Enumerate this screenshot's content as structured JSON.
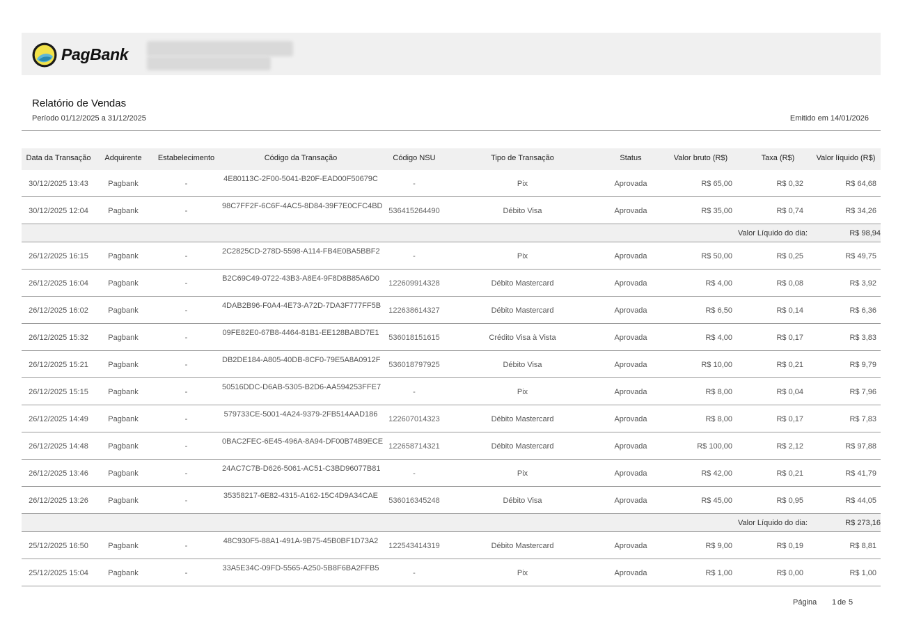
{
  "brand": {
    "name": "PagBank"
  },
  "report": {
    "title": "Relatório de Vendas",
    "period": "Período 01/12/2025 a 31/12/2025",
    "issued": "Emitido em 14/01/2026"
  },
  "table": {
    "headers": {
      "date": "Data da Transação",
      "acquirer": "Adquirente",
      "establishment": "Estabelecimento",
      "code": "Código da Transação",
      "nsu": "Código NSU",
      "type": "Tipo de Transação",
      "status": "Status",
      "gross": "Valor bruto (R$)",
      "fee": "Taxa (R$)",
      "net": "Valor líquido (R$)"
    },
    "sections": [
      {
        "rows": [
          {
            "date": "30/12/2025 13:43",
            "acquirer": "Pagbank",
            "establishment": "-",
            "code": "4E80113C-2F00-5041-B20F-EAD00F50679C",
            "nsu": "-",
            "type": "Pix",
            "status": "Aprovada",
            "gross": "R$ 65,00",
            "fee": "R$ 0,32",
            "net": "R$ 64,68"
          },
          {
            "date": "30/12/2025 12:04",
            "acquirer": "Pagbank",
            "establishment": "-",
            "code": "98C7FF2F-6C6F-4AC5-8D84-39F7E0CFC4BD",
            "nsu": "536415264490",
            "type": "Débito Visa",
            "status": "Aprovada",
            "gross": "R$ 35,00",
            "fee": "R$ 0,74",
            "net": "R$ 34,26"
          }
        ],
        "subtotal_label": "Valor Líquido do dia:",
        "subtotal_value": "R$ 98,94"
      },
      {
        "rows": [
          {
            "date": "26/12/2025 16:15",
            "acquirer": "Pagbank",
            "establishment": "-",
            "code": "2C2825CD-278D-5598-A114-FB4E0BA5BBF2",
            "nsu": "-",
            "type": "Pix",
            "status": "Aprovada",
            "gross": "R$ 50,00",
            "fee": "R$ 0,25",
            "net": "R$ 49,75"
          },
          {
            "date": "26/12/2025 16:04",
            "acquirer": "Pagbank",
            "establishment": "-",
            "code": "B2C69C49-0722-43B3-A8E4-9F8D8B85A6D0",
            "nsu": "122609914328",
            "type": "Débito Mastercard",
            "status": "Aprovada",
            "gross": "R$ 4,00",
            "fee": "R$ 0,08",
            "net": "R$ 3,92"
          },
          {
            "date": "26/12/2025 16:02",
            "acquirer": "Pagbank",
            "establishment": "-",
            "code": "4DAB2B96-F0A4-4E73-A72D-7DA3F777FF5B",
            "nsu": "122638614327",
            "type": "Débito Mastercard",
            "status": "Aprovada",
            "gross": "R$ 6,50",
            "fee": "R$ 0,14",
            "net": "R$ 6,36"
          },
          {
            "date": "26/12/2025 15:32",
            "acquirer": "Pagbank",
            "establishment": "-",
            "code": "09FE82E0-67B8-4464-81B1-EE128BABD7E1",
            "nsu": "536018151615",
            "type": "Crédito Visa à Vista",
            "status": "Aprovada",
            "gross": "R$ 4,00",
            "fee": "R$ 0,17",
            "net": "R$ 3,83"
          },
          {
            "date": "26/12/2025 15:21",
            "acquirer": "Pagbank",
            "establishment": "-",
            "code": "DB2DE184-A805-40DB-8CF0-79E5A8A0912F",
            "nsu": "536018797925",
            "type": "Débito Visa",
            "status": "Aprovada",
            "gross": "R$ 10,00",
            "fee": "R$ 0,21",
            "net": "R$ 9,79"
          },
          {
            "date": "26/12/2025 15:15",
            "acquirer": "Pagbank",
            "establishment": "-",
            "code": "50516DDC-D6AB-5305-B2D6-AA594253FFE7",
            "nsu": "-",
            "type": "Pix",
            "status": "Aprovada",
            "gross": "R$ 8,00",
            "fee": "R$ 0,04",
            "net": "R$ 7,96"
          },
          {
            "date": "26/12/2025 14:49",
            "acquirer": "Pagbank",
            "establishment": "-",
            "code": "579733CE-5001-4A24-9379-2FB514AAD186",
            "nsu": "122607014323",
            "type": "Débito Mastercard",
            "status": "Aprovada",
            "gross": "R$ 8,00",
            "fee": "R$ 0,17",
            "net": "R$ 7,83"
          },
          {
            "date": "26/12/2025 14:48",
            "acquirer": "Pagbank",
            "establishment": "-",
            "code": "0BAC2FEC-6E45-496A-8A94-DF00B74B9ECE",
            "nsu": "122658714321",
            "type": "Débito Mastercard",
            "status": "Aprovada",
            "gross": "R$ 100,00",
            "fee": "R$ 2,12",
            "net": "R$ 97,88"
          },
          {
            "date": "26/12/2025 13:46",
            "acquirer": "Pagbank",
            "establishment": "-",
            "code": "24AC7C7B-D626-5061-AC51-C3BD96077B81",
            "nsu": "-",
            "type": "Pix",
            "status": "Aprovada",
            "gross": "R$ 42,00",
            "fee": "R$ 0,21",
            "net": "R$ 41,79"
          },
          {
            "date": "26/12/2025 13:26",
            "acquirer": "Pagbank",
            "establishment": "-",
            "code": "35358217-6E82-4315-A162-15C4D9A34CAE",
            "nsu": "536016345248",
            "type": "Débito Visa",
            "status": "Aprovada",
            "gross": "R$ 45,00",
            "fee": "R$ 0,95",
            "net": "R$ 44,05"
          }
        ],
        "subtotal_label": "Valor Líquido do dia:",
        "subtotal_value": "R$ 273,16"
      },
      {
        "rows": [
          {
            "date": "25/12/2025 16:50",
            "acquirer": "Pagbank",
            "establishment": "-",
            "code": "48C930F5-88A1-491A-9B75-45B0BF1D73A2",
            "nsu": "122543414319",
            "type": "Débito Mastercard",
            "status": "Aprovada",
            "gross": "R$ 9,00",
            "fee": "R$ 0,19",
            "net": "R$ 8,81"
          },
          {
            "date": "25/12/2025 15:04",
            "acquirer": "Pagbank",
            "establishment": "-",
            "code": "33A5E34C-09FD-5565-A250-5B8F6BA2FFB5",
            "nsu": "-",
            "type": "Pix",
            "status": "Aprovada",
            "gross": "R$ 1,00",
            "fee": "R$ 0,00",
            "net": "R$ 1,00"
          }
        ]
      }
    ]
  },
  "footer": {
    "page_label": "Página",
    "page_current": "1",
    "page_of": "de",
    "page_total": "5"
  }
}
